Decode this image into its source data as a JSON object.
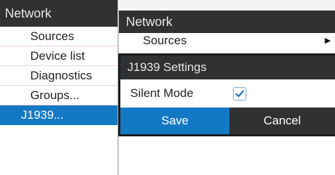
{
  "back_menu": {
    "title": "Network",
    "items": [
      {
        "label": "Sources"
      },
      {
        "label": "Device list"
      },
      {
        "label": "Diagnostics"
      },
      {
        "label": "Groups..."
      },
      {
        "label": "J1939...",
        "selected": true
      }
    ]
  },
  "front_menu": {
    "title": "Network",
    "sources_label": "Sources",
    "sources_arrow_icon": "triangle-right-icon"
  },
  "dialog": {
    "title": "J1939 Settings",
    "silent_mode_label": "Silent Mode",
    "silent_mode_checked": true,
    "save_label": "Save",
    "cancel_label": "Cancel"
  },
  "colors": {
    "accent": "#1479c4",
    "header": "#2f3133"
  }
}
